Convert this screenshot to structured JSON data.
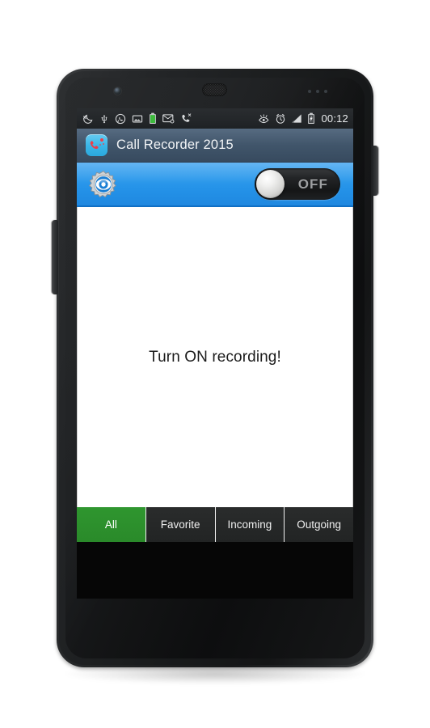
{
  "statusbar": {
    "left_icons": [
      {
        "name": "do-not-disturb-icon",
        "label": "Do not disturb"
      },
      {
        "name": "usb-icon",
        "label": "USB connected"
      },
      {
        "name": "whatsapp-icon",
        "label": "WhatsApp"
      },
      {
        "name": "screenshot-icon",
        "label": "Screenshot captured"
      },
      {
        "name": "battery-status-icon",
        "label": "Battery"
      },
      {
        "name": "email-icon",
        "label": "New email"
      },
      {
        "name": "missed-call-icon",
        "label": "Missed call"
      }
    ],
    "right_icons": [
      {
        "name": "smart-stay-eye-icon",
        "label": "Smart stay"
      },
      {
        "name": "alarm-clock-icon",
        "label": "Alarm set"
      },
      {
        "name": "signal-bars-icon",
        "label": "Signal strength"
      },
      {
        "name": "charging-battery-icon",
        "label": "Charging"
      }
    ],
    "clock": "00:12"
  },
  "titlebar": {
    "app_icon_name": "call-recorder-app-icon",
    "title": "Call Recorder 2015"
  },
  "toggle_bar": {
    "settings_icon_name": "settings-gear-eye-icon",
    "switch_label": "OFF",
    "switch_state": "off"
  },
  "content": {
    "empty_message": "Turn ON recording!"
  },
  "tabs": [
    {
      "label": "All",
      "active": true
    },
    {
      "label": "Favorite",
      "active": false
    },
    {
      "label": "Incoming",
      "active": false
    },
    {
      "label": "Outgoing",
      "active": false
    }
  ],
  "colors": {
    "title_bar": "#3d5166",
    "toggle_bar_blue": "#2492e8",
    "active_tab_green": "#2a8a2a",
    "tab_bar_dark": "#222424",
    "content_background": "#ffffff",
    "app_icon_blue": "#3bb6e8",
    "app_icon_red": "#ef3b46"
  }
}
